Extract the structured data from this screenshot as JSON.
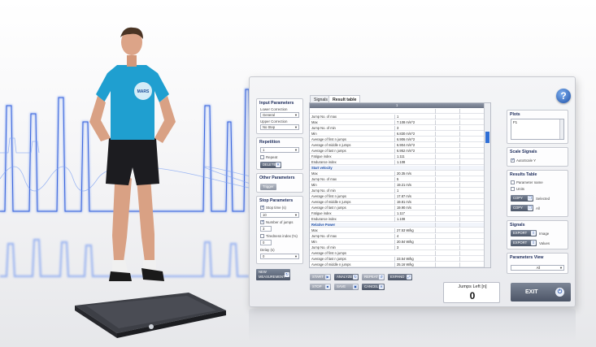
{
  "colors": {
    "accent": "#1f4fa8",
    "wave": "#3f6fe0",
    "panel_border": "#c5c8d0",
    "button_dark": "#4e586a"
  },
  "left_panels": {
    "input_parameters": {
      "title": "Input Parameters",
      "lower_correction_label": "Lower Correction",
      "lower_correction_value": "General",
      "upper_correction_label": "Upper Correction",
      "upper_correction_value": "No Step"
    },
    "repetition": {
      "title": "Repetition",
      "count_value": "1",
      "repeat_label": "Repeat",
      "delete_button": "DELETE"
    },
    "other_parameters": {
      "title": "Other Parameters",
      "button": "Trigger"
    },
    "stop_parameters": {
      "title": "Stop Parameters",
      "stop_time_label": "Stop time (s)",
      "stop_time_value": "10",
      "number_of_jumps_label": "Number of jumps",
      "number_of_jumps_value": "3",
      "tiredness_label": "Tiredness index (%)",
      "tiredness_value": "0",
      "delay_label": "Delay (s)",
      "delay_value": "0"
    },
    "new_measurement_button": "NEW MEASUREMENT"
  },
  "tabs": [
    {
      "label": "Signals"
    },
    {
      "label": "Result table"
    }
  ],
  "result_table": {
    "header": "1",
    "rows": [
      {
        "label": "",
        "value": ""
      },
      {
        "label": "Jump No. of max",
        "value": "1"
      },
      {
        "label": "Max",
        "value": "7.108 m/s^2"
      },
      {
        "label": "Jump No. of min",
        "value": "3"
      },
      {
        "label": "Min",
        "value": "6.830 m/s^2"
      },
      {
        "label": "Average of first n jumps",
        "value": "6.906 m/s^2"
      },
      {
        "label": "Average of middle n jumps",
        "value": "6.904 m/s^2"
      },
      {
        "label": "Average of last n jumps",
        "value": "6.952 m/s^2"
      },
      {
        "label": "Fatigue index",
        "value": "1.111"
      },
      {
        "label": "Endurance index",
        "value": "1.108"
      },
      {
        "label": "Start velocity",
        "value": "",
        "section": true
      },
      {
        "label": "Max",
        "value": "20.35 m/s"
      },
      {
        "label": "Jump No. of max",
        "value": "5"
      },
      {
        "label": "Min",
        "value": "19.21 m/s"
      },
      {
        "label": "Jump No. of min",
        "value": "1"
      },
      {
        "label": "Average of first n jumps",
        "value": "17.87 m/s"
      },
      {
        "label": "Average of middle n jumps",
        "value": "19.81 m/s"
      },
      {
        "label": "Average of last n jumps",
        "value": "19.90 m/s"
      },
      {
        "label": "Fatigue index",
        "value": "1.117"
      },
      {
        "label": "Endurance index",
        "value": "1.108"
      },
      {
        "label": "Relative Power",
        "value": "",
        "section": true
      },
      {
        "label": "Max",
        "value": "27.53 W/kg"
      },
      {
        "label": "Jump No. of max",
        "value": "4"
      },
      {
        "label": "Min",
        "value": "20.84 W/kg"
      },
      {
        "label": "Jump No. of min",
        "value": "3"
      },
      {
        "label": "Average of first n jumps",
        "value": ""
      },
      {
        "label": "Average of last n jumps",
        "value": "23.54 W/kg"
      },
      {
        "label": "Average of middle n jumps",
        "value": "25.16 W/kg"
      }
    ]
  },
  "toolbar": {
    "start": "START",
    "analyze": "ANALYZE",
    "repeat": "REPEAT",
    "expand": "EXPAND",
    "stop": "STOP",
    "save": "SAVE",
    "cancel": "CANCEL"
  },
  "jumps_left": {
    "label": "Jumps Left [n]",
    "value": "0"
  },
  "exit_button": "EXIT",
  "help_button": "?",
  "right_panels": {
    "plots": {
      "title": "Plots",
      "item": "F1"
    },
    "scale_signals": {
      "title": "Scale Signals",
      "autoscale_label": "AutoScale Y"
    },
    "results_table": {
      "title": "Results Table",
      "parameter_name_label": "Parameter name",
      "units_label": "Units",
      "copy_label": "COPY",
      "selected_label": "Selected",
      "all_label": "All"
    },
    "signals": {
      "title": "Signals",
      "export_label": "EXPORT",
      "image_label": "Image",
      "values_label": "Values"
    },
    "parameters_view": {
      "title": "Parameters View",
      "value": "All"
    }
  },
  "shirt_text": "MARS"
}
